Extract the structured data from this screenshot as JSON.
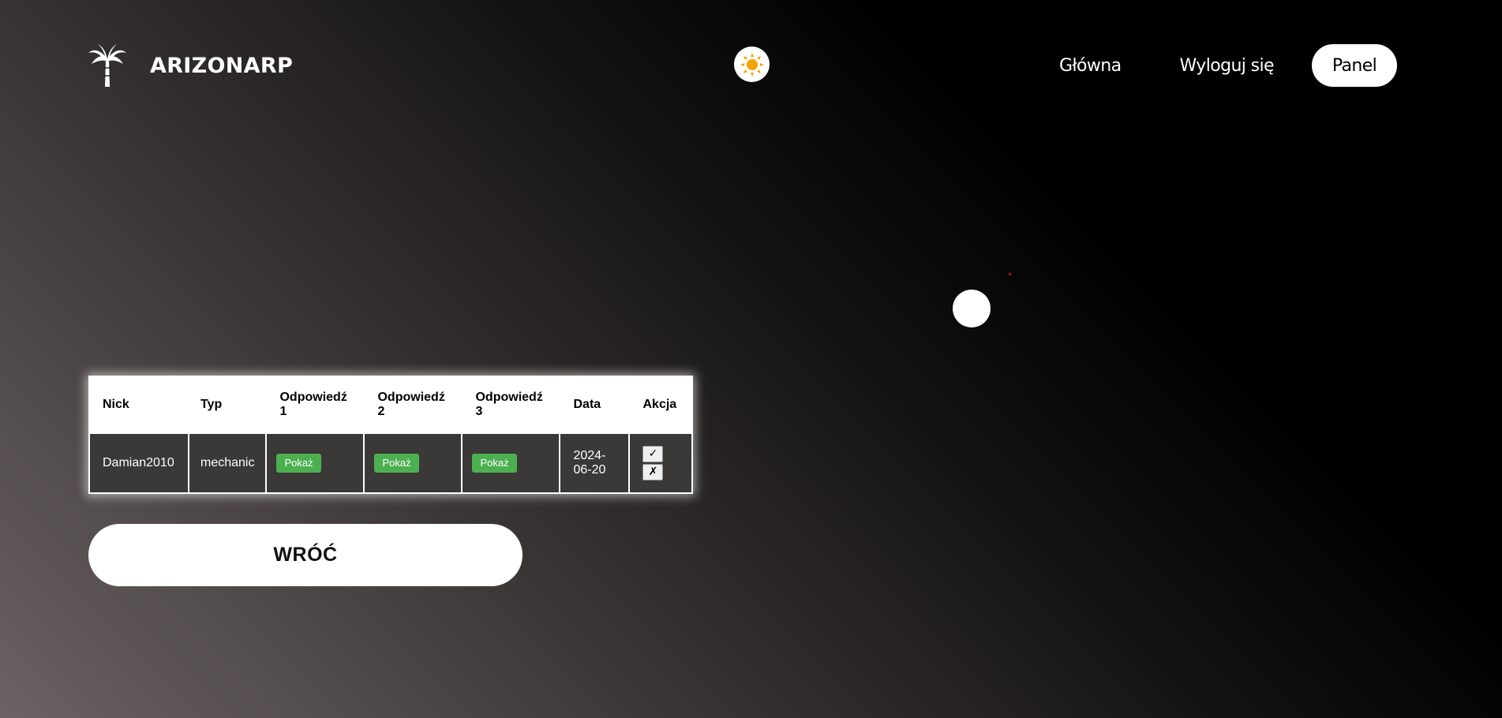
{
  "header": {
    "brand": "ARIZONARP",
    "logo_icon": "palm-tree-icon",
    "theme_icon": "sun-icon",
    "nav": {
      "home": "Główna",
      "logout": "Wyloguj się",
      "panel": "Panel"
    }
  },
  "table": {
    "columns": [
      "Nick",
      "Typ",
      "Odpowiedź 1",
      "Odpowiedź 2",
      "Odpowiedź 3",
      "Data",
      "Akcja"
    ],
    "rows": [
      {
        "nick": "Damian2010",
        "typ": "mechanic",
        "answer1": "Pokaż",
        "answer2": "Pokaż",
        "answer3": "Pokaż",
        "date": "2024-06-20",
        "accept": "✓",
        "reject": "✗"
      }
    ]
  },
  "back_button": "WRÓĆ",
  "colors": {
    "show_button": "#4caf50",
    "sun": "#f5a300"
  }
}
